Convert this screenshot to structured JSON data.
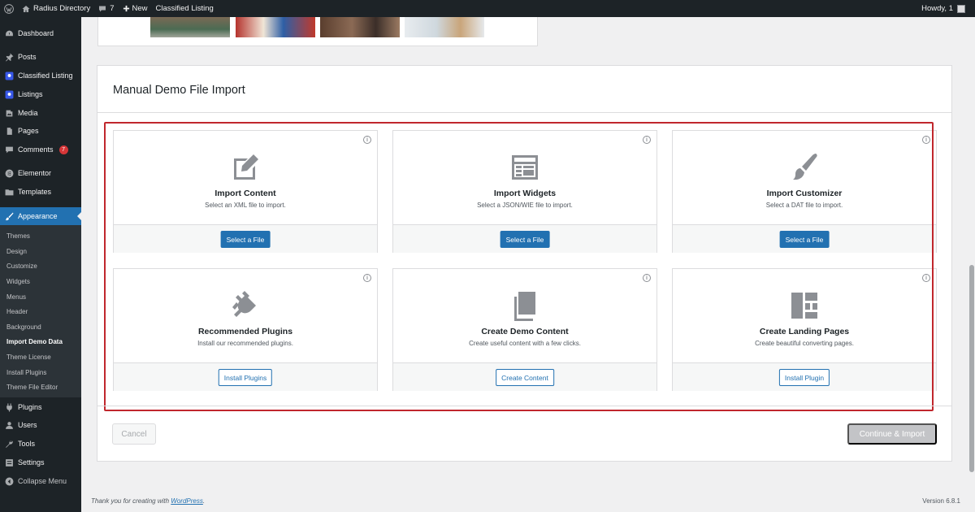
{
  "adminbar": {
    "site_name": "Radius Directory",
    "comments_count": "7",
    "new_label": "New",
    "classified_label": "Classified Listing",
    "howdy": "Howdy, 1"
  },
  "sidebar": {
    "items": {
      "dashboard": "Dashboard",
      "posts": "Posts",
      "classified": "Classified Listing",
      "listings": "Listings",
      "media": "Media",
      "pages": "Pages",
      "comments": "Comments",
      "comments_badge": "7",
      "elementor": "Elementor",
      "templates": "Templates",
      "appearance": "Appearance",
      "plugins": "Plugins",
      "users": "Users",
      "tools": "Tools",
      "settings": "Settings",
      "collapse": "Collapse Menu"
    },
    "submenu": {
      "themes": "Themes",
      "design": "Design",
      "customize": "Customize",
      "widgets": "Widgets",
      "menus": "Menus",
      "header": "Header",
      "background": "Background",
      "import_demo": "Import Demo Data",
      "theme_license": "Theme License",
      "install_plugins": "Install Plugins",
      "theme_file_editor": "Theme File Editor"
    }
  },
  "panel": {
    "title": "Manual Demo File Import",
    "info_glyph": "i",
    "cards": {
      "import_content": {
        "title": "Import Content",
        "desc": "Select an XML file to import.",
        "button": "Select a File"
      },
      "import_widgets": {
        "title": "Import Widgets",
        "desc": "Select a JSON/WIE file to import.",
        "button": "Select a File"
      },
      "import_customizer": {
        "title": "Import Customizer",
        "desc": "Select a DAT file to import.",
        "button": "Select a File"
      },
      "recommended_plugins": {
        "title": "Recommended Plugins",
        "desc": "Install our recommended plugins.",
        "button": "Install Plugins"
      },
      "create_demo_content": {
        "title": "Create Demo Content",
        "desc": "Create useful content with a few clicks.",
        "button": "Create Content"
      },
      "create_landing_pages": {
        "title": "Create Landing Pages",
        "desc": "Create beautiful converting pages.",
        "button": "Install Plugin"
      }
    },
    "cancel": "Cancel",
    "continue": "Continue & Import"
  },
  "footer": {
    "thanks_prefix": "Thank you for creating with ",
    "wordpress": "WordPress",
    "thanks_suffix": ".",
    "version": "Version 6.8.1"
  }
}
